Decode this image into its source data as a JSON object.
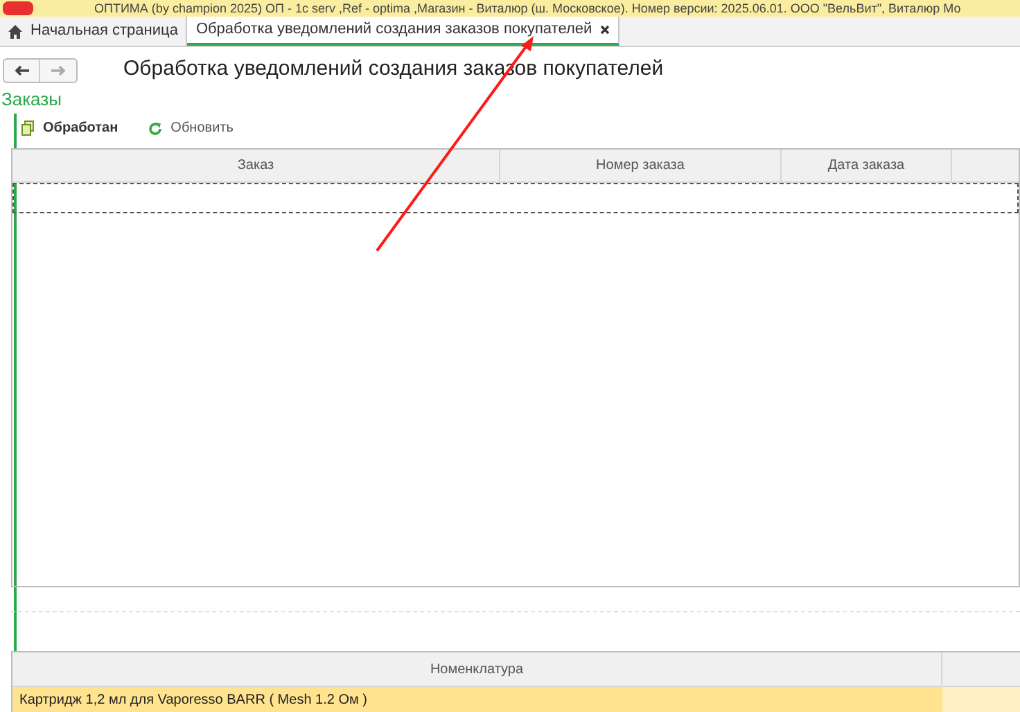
{
  "window": {
    "title": "ОПТИМА (by champion 2025) ОП - 1c serv ,Ref - optima ,Магазин - Виталюр (ш. Московское). Номер версии: 2025.06.01. ООО \"ВельВит\", Виталюр Мо"
  },
  "tabs": [
    {
      "label": "Начальная страница",
      "kind": "home",
      "selected": false
    },
    {
      "label": "Обработка уведомлений создания заказов покупателей",
      "kind": "form",
      "selected": true
    }
  ],
  "form": {
    "title": "Обработка уведомлений создания заказов покупателей"
  },
  "orders": {
    "title": "Заказы",
    "toolbar": [
      {
        "label": "Обработан",
        "kind": "processed"
      },
      {
        "label": "Обновить",
        "kind": "refresh"
      }
    ],
    "table": {
      "columns": [
        "Заказ",
        "Номер заказа",
        "Дата заказа"
      ],
      "rows": [
        {
          "selected": true
        }
      ]
    }
  },
  "items": {
    "table": {
      "columns": [
        "Номенклатура"
      ],
      "rows": [
        {
          "cells": [
            "Картридж 1,2 мл для Vaporesso BARR ( Mesh 1.2 Ом )"
          ],
          "selected": true
        }
      ]
    }
  }
}
